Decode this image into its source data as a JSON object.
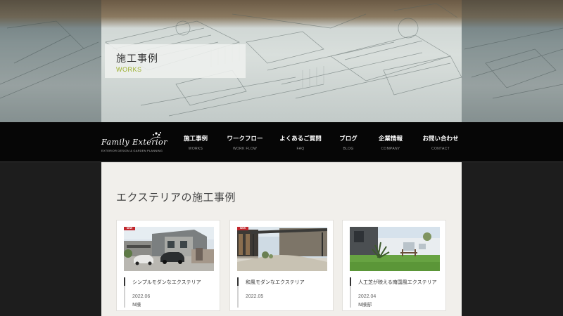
{
  "hero": {
    "title": "施工事例",
    "subtitle": "WORKS"
  },
  "logo": {
    "name": "Family Exterior",
    "tagline": "EXTERIOR DESIGN & GARDEN PLANNING"
  },
  "nav": {
    "items": [
      {
        "label": "施工事例",
        "sub": "WORKS"
      },
      {
        "label": "ワークフロー",
        "sub": "WORK FLOW"
      },
      {
        "label": "よくあるご質問",
        "sub": "FAQ"
      },
      {
        "label": "ブログ",
        "sub": "BLOG"
      },
      {
        "label": "企業情報",
        "sub": "COMPANY"
      },
      {
        "label": "お問い合わせ",
        "sub": "CONTACT"
      }
    ]
  },
  "main": {
    "section_title": "エクステリアの施工事例",
    "cards": [
      {
        "badge": "NEW",
        "title": "シンプルモダンなエクステリア",
        "date": "2022.06",
        "author": "N様"
      },
      {
        "badge": "NEW",
        "title": "和風モダンなエクステリア",
        "date": "2022.05",
        "author": ""
      },
      {
        "badge": "",
        "title": "人工芝が映える南国風エクステリア",
        "date": "2022.04",
        "author": "N様邸"
      }
    ]
  },
  "colors": {
    "accent_green": "#9cb02c",
    "badge_red": "#c1272d",
    "nav_background": "#060606",
    "main_background": "#f1efeb"
  }
}
